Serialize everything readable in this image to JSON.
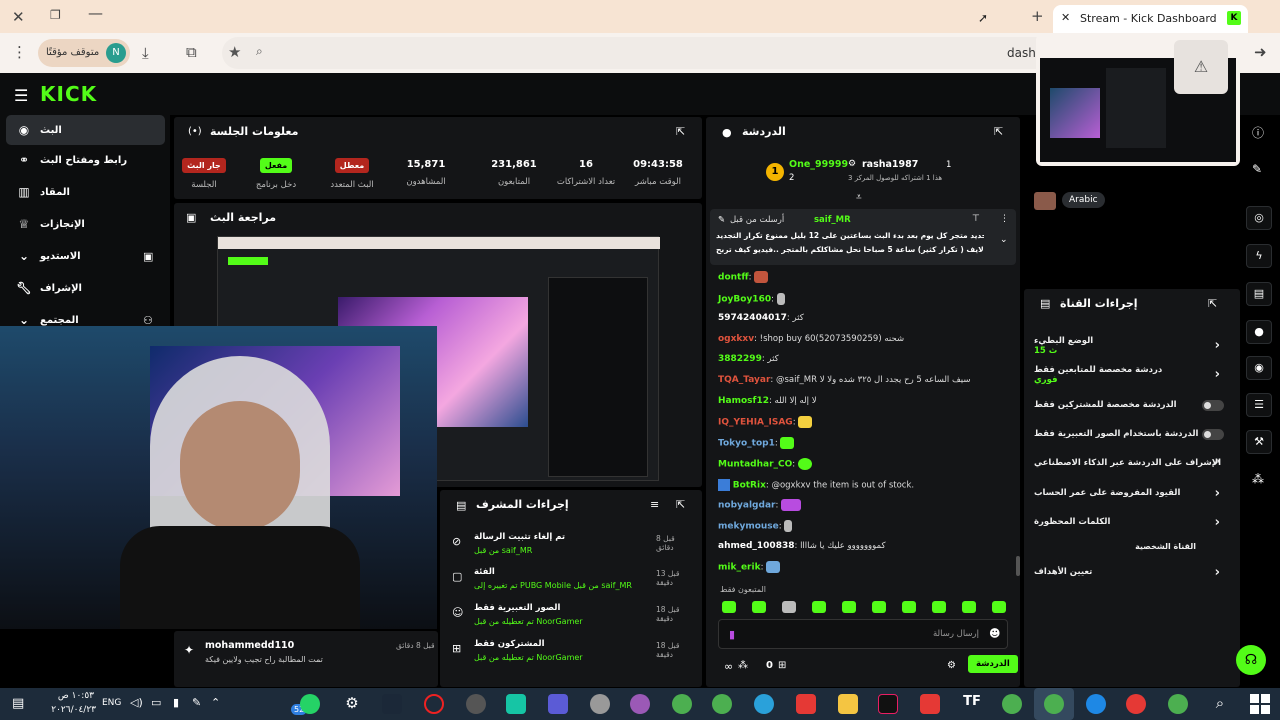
{
  "browser": {
    "tab_title": "Stream - Kick Dashboard",
    "profile_label": "متوقف مؤقتًا",
    "profile_initial": "N",
    "url_fragment": "dashb"
  },
  "sidebar": {
    "items": [
      {
        "label": "البث"
      },
      {
        "label": "رابط ومفتاح البث"
      },
      {
        "label": "المقاد"
      },
      {
        "label": "الإنجازات"
      },
      {
        "label": "الاستديو"
      },
      {
        "label": "الإشراف"
      },
      {
        "label": "المجتمع"
      }
    ]
  },
  "session": {
    "title": "معلومات الجلسة",
    "stats": [
      {
        "value": "09:43:58",
        "label": "الوقت مباشر"
      },
      {
        "value": "16",
        "label": "تعداد الاشتراكات"
      },
      {
        "value": "231,861",
        "label": "المتابعون"
      },
      {
        "value": "15,871",
        "label": "المشاهدون"
      },
      {
        "badge": "معطل",
        "label": "البث المتعدد"
      },
      {
        "badge": "مفعل",
        "label": "دخل برنامج"
      },
      {
        "badge": "جار البث",
        "label": "الجلسة"
      }
    ]
  },
  "preview": {
    "title": "مراجعة البث"
  },
  "chat": {
    "title": "الدردشة",
    "top_gifters": [
      {
        "name": "One_99999",
        "count": "2"
      },
      {
        "name": "rasha1987",
        "count": "1",
        "note": "هذا 1 اشتراكه للوصول المركز 3"
      }
    ],
    "pinned": {
      "by": "أرسلت من قبل",
      "user": "saif_MR",
      "text1": "يتم تجديد متجر كل يوم بعد بدء البث بساعتين على 12 بليل ممنوع تكرار التجديد",
      "text2": "ضمن الايف ( تكرار كثير) ساعة 5 صباحا نحل مشاكلكم بالمتجر ..فيديو كيف تربح"
    },
    "messages": [
      {
        "user": "dontff",
        "text": "",
        "color": "#53fc18"
      },
      {
        "user": "JoyBoy160",
        "text": "",
        "color": "#53fc18"
      },
      {
        "user": "59742404017",
        "text": "كثر",
        "color": "#fff"
      },
      {
        "user": "ogxkxv",
        "text": "!shop buy 60(52073590259) شحنه",
        "color": "#e0533d"
      },
      {
        "user": "3882299",
        "text": "كثر",
        "color": "#53fc18"
      },
      {
        "user": "TQA_Tayar",
        "text": "@saif_MR سيف الساعه 5 رح يجدد ال ٣٢٥ شده ولا لا",
        "color": "#e0533d"
      },
      {
        "user": "Hamosf12",
        "text": "لا إله إلا الله",
        "color": "#53fc18"
      },
      {
        "user": "IQ_YEHIA_ISAG",
        "text": "",
        "color": "#e0533d"
      },
      {
        "user": "Tokyo_top1",
        "text": "",
        "color": "#6fa8dc"
      },
      {
        "user": "Muntadhar_CO",
        "text": "",
        "color": "#53fc18"
      },
      {
        "user": "BotRix",
        "text": "@ogxkxv the item is out of stock.",
        "color": "#53fc18"
      },
      {
        "user": "nobyalgdar",
        "text": "",
        "color": "#6fa8dc"
      },
      {
        "user": "mekymouse",
        "text": "",
        "color": "#6fa8dc"
      },
      {
        "user": "ahmed_100838",
        "text": "كمووووووو عليك يا شاااا",
        "color": "#fff"
      },
      {
        "user": "mik_erik",
        "text": "",
        "color": "#53fc18"
      }
    ],
    "followers_only": "المتبعون فقط",
    "input_placeholder": "إرسال رسالة",
    "send_label": "الدردشة",
    "points": "0"
  },
  "mod_actions": {
    "title": "إجراءات المشرف",
    "items": [
      {
        "title": "تم إلغاء تثبيت الرسالة",
        "sub": "من قبل saif_MR",
        "time": "قبل 8 دقائق"
      },
      {
        "title": "الفئة",
        "sub": "تم تغييره إلى PUBG Mobile من قبل saif_MR",
        "time": "قبل 13 دقيقة"
      },
      {
        "title": "الصور التعبيرية فقط",
        "sub": "تم تعطيله من قبل NoorGamer",
        "time": "قبل 18 دقيقة"
      },
      {
        "title": "المشتركون فقط",
        "sub": "تم تعطيله من قبل NoorGamer",
        "time": "قبل 18 دقيقة"
      }
    ]
  },
  "activity": {
    "user": "mohammedd110",
    "text": "تمت المطالبة راح تجيب ولايين فيكة",
    "time": "قبل 8 دقائق"
  },
  "channel_actions": {
    "title": "إجراءات القناة",
    "language": "Arabic",
    "items": [
      {
        "label": "الوضع البطيء",
        "sub": "15 ث",
        "type": "arrow"
      },
      {
        "label": "دردشة مخصصة للمتابعين فقط",
        "sub": "فوري",
        "type": "arrow"
      },
      {
        "label": "الدردشة مخصصة للمشتركين فقط",
        "type": "toggle"
      },
      {
        "label": "الدردشة باستخدام الصور التعبيرية فقط",
        "type": "toggle"
      },
      {
        "label": "الإشراف على الدردشة عبر الذكاء الاصطناعي",
        "type": "ext"
      },
      {
        "label": "القيود المفروضة على عمر الحساب",
        "type": "arrow"
      },
      {
        "label": "الكلمات المحظورة",
        "type": "arrow"
      }
    ],
    "section": "القناة الشخصية",
    "goals": "تعيين الأهداف"
  },
  "taskbar": {
    "time": "١٠:٥٣ ص",
    "date": "٢٠٢٦/٠٤/٢٣",
    "lang": "ENG",
    "notif": "52"
  },
  "colors": {
    "accent": "#53fc18",
    "panel": "#141517",
    "danger": "#e0533d"
  }
}
